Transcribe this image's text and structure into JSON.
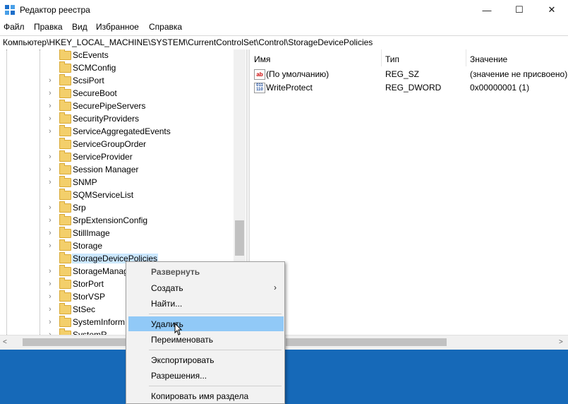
{
  "window": {
    "title": "Редактор реестра",
    "minimize_glyph": "—",
    "maximize_glyph": "☐",
    "close_glyph": "✕"
  },
  "menu": [
    "Файл",
    "Правка",
    "Вид",
    "Избранное",
    "Справка"
  ],
  "address": "Компьютер\\HKEY_LOCAL_MACHINE\\SYSTEM\\CurrentControlSet\\Control\\StorageDevicePolicies",
  "tree": [
    {
      "label": "ScEvents",
      "expandable": false
    },
    {
      "label": "SCMConfig",
      "expandable": false
    },
    {
      "label": "ScsiPort",
      "expandable": true
    },
    {
      "label": "SecureBoot",
      "expandable": true
    },
    {
      "label": "SecurePipeServers",
      "expandable": true
    },
    {
      "label": "SecurityProviders",
      "expandable": true
    },
    {
      "label": "ServiceAggregatedEvents",
      "expandable": true
    },
    {
      "label": "ServiceGroupOrder",
      "expandable": false
    },
    {
      "label": "ServiceProvider",
      "expandable": true
    },
    {
      "label": "Session Manager",
      "expandable": true
    },
    {
      "label": "SNMP",
      "expandable": true
    },
    {
      "label": "SQMServiceList",
      "expandable": false
    },
    {
      "label": "Srp",
      "expandable": true
    },
    {
      "label": "SrpExtensionConfig",
      "expandable": true
    },
    {
      "label": "StillImage",
      "expandable": true
    },
    {
      "label": "Storage",
      "expandable": true
    },
    {
      "label": "StorageDevicePolicies",
      "expandable": false,
      "selected": true
    },
    {
      "label": "StorageManag",
      "expandable": true
    },
    {
      "label": "StorPort",
      "expandable": true
    },
    {
      "label": "StorVSP",
      "expandable": true
    },
    {
      "label": "StSec",
      "expandable": true
    },
    {
      "label": "SystemInform",
      "expandable": true
    },
    {
      "label": "SystemR",
      "expandable": true
    }
  ],
  "columns": {
    "name": "Имя",
    "type": "Тип",
    "value": "Значение"
  },
  "values": [
    {
      "icon": "string-value-icon",
      "icon_text": "ab",
      "name": "(По умолчанию)",
      "type": "REG_SZ",
      "data": "(значение не присвоено)"
    },
    {
      "icon": "binary-value-icon",
      "icon_text": "011\n110",
      "name": "WriteProtect",
      "type": "REG_DWORD",
      "data": "0x00000001 (1)"
    }
  ],
  "context_menu": {
    "expand": "Развернуть",
    "create": "Создать",
    "find": "Найти...",
    "delete": "Удалить",
    "rename": "Переименовать",
    "export": "Экспортировать",
    "permissions": "Разрешения...",
    "copy_key_name": "Копировать имя раздела"
  },
  "scroll": {
    "left_arrow": "<",
    "right_arrow": ">"
  },
  "colors": {
    "selection": "#cce8ff",
    "menu_highlight": "#91c9f7",
    "desktop": "#1669b8"
  }
}
